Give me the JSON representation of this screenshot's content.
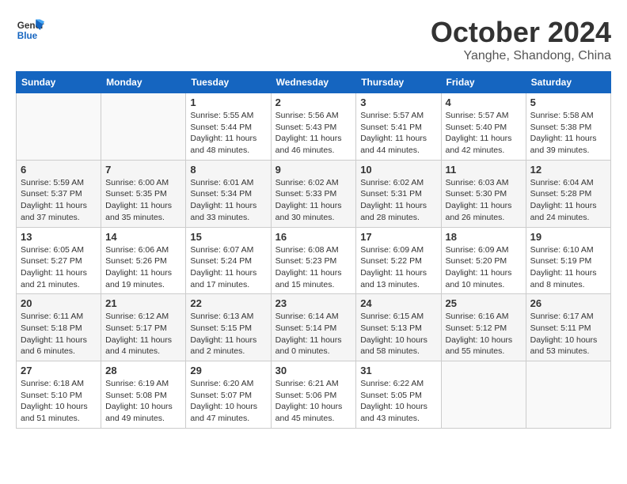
{
  "header": {
    "logo_line1": "General",
    "logo_line2": "Blue",
    "title": "October 2024",
    "subtitle": "Yanghe, Shandong, China"
  },
  "columns": [
    "Sunday",
    "Monday",
    "Tuesday",
    "Wednesday",
    "Thursday",
    "Friday",
    "Saturday"
  ],
  "weeks": [
    [
      {
        "day": "",
        "info": ""
      },
      {
        "day": "",
        "info": ""
      },
      {
        "day": "1",
        "info": "Sunrise: 5:55 AM\nSunset: 5:44 PM\nDaylight: 11 hours and 48 minutes."
      },
      {
        "day": "2",
        "info": "Sunrise: 5:56 AM\nSunset: 5:43 PM\nDaylight: 11 hours and 46 minutes."
      },
      {
        "day": "3",
        "info": "Sunrise: 5:57 AM\nSunset: 5:41 PM\nDaylight: 11 hours and 44 minutes."
      },
      {
        "day": "4",
        "info": "Sunrise: 5:57 AM\nSunset: 5:40 PM\nDaylight: 11 hours and 42 minutes."
      },
      {
        "day": "5",
        "info": "Sunrise: 5:58 AM\nSunset: 5:38 PM\nDaylight: 11 hours and 39 minutes."
      }
    ],
    [
      {
        "day": "6",
        "info": "Sunrise: 5:59 AM\nSunset: 5:37 PM\nDaylight: 11 hours and 37 minutes."
      },
      {
        "day": "7",
        "info": "Sunrise: 6:00 AM\nSunset: 5:35 PM\nDaylight: 11 hours and 35 minutes."
      },
      {
        "day": "8",
        "info": "Sunrise: 6:01 AM\nSunset: 5:34 PM\nDaylight: 11 hours and 33 minutes."
      },
      {
        "day": "9",
        "info": "Sunrise: 6:02 AM\nSunset: 5:33 PM\nDaylight: 11 hours and 30 minutes."
      },
      {
        "day": "10",
        "info": "Sunrise: 6:02 AM\nSunset: 5:31 PM\nDaylight: 11 hours and 28 minutes."
      },
      {
        "day": "11",
        "info": "Sunrise: 6:03 AM\nSunset: 5:30 PM\nDaylight: 11 hours and 26 minutes."
      },
      {
        "day": "12",
        "info": "Sunrise: 6:04 AM\nSunset: 5:28 PM\nDaylight: 11 hours and 24 minutes."
      }
    ],
    [
      {
        "day": "13",
        "info": "Sunrise: 6:05 AM\nSunset: 5:27 PM\nDaylight: 11 hours and 21 minutes."
      },
      {
        "day": "14",
        "info": "Sunrise: 6:06 AM\nSunset: 5:26 PM\nDaylight: 11 hours and 19 minutes."
      },
      {
        "day": "15",
        "info": "Sunrise: 6:07 AM\nSunset: 5:24 PM\nDaylight: 11 hours and 17 minutes."
      },
      {
        "day": "16",
        "info": "Sunrise: 6:08 AM\nSunset: 5:23 PM\nDaylight: 11 hours and 15 minutes."
      },
      {
        "day": "17",
        "info": "Sunrise: 6:09 AM\nSunset: 5:22 PM\nDaylight: 11 hours and 13 minutes."
      },
      {
        "day": "18",
        "info": "Sunrise: 6:09 AM\nSunset: 5:20 PM\nDaylight: 11 hours and 10 minutes."
      },
      {
        "day": "19",
        "info": "Sunrise: 6:10 AM\nSunset: 5:19 PM\nDaylight: 11 hours and 8 minutes."
      }
    ],
    [
      {
        "day": "20",
        "info": "Sunrise: 6:11 AM\nSunset: 5:18 PM\nDaylight: 11 hours and 6 minutes."
      },
      {
        "day": "21",
        "info": "Sunrise: 6:12 AM\nSunset: 5:17 PM\nDaylight: 11 hours and 4 minutes."
      },
      {
        "day": "22",
        "info": "Sunrise: 6:13 AM\nSunset: 5:15 PM\nDaylight: 11 hours and 2 minutes."
      },
      {
        "day": "23",
        "info": "Sunrise: 6:14 AM\nSunset: 5:14 PM\nDaylight: 11 hours and 0 minutes."
      },
      {
        "day": "24",
        "info": "Sunrise: 6:15 AM\nSunset: 5:13 PM\nDaylight: 10 hours and 58 minutes."
      },
      {
        "day": "25",
        "info": "Sunrise: 6:16 AM\nSunset: 5:12 PM\nDaylight: 10 hours and 55 minutes."
      },
      {
        "day": "26",
        "info": "Sunrise: 6:17 AM\nSunset: 5:11 PM\nDaylight: 10 hours and 53 minutes."
      }
    ],
    [
      {
        "day": "27",
        "info": "Sunrise: 6:18 AM\nSunset: 5:10 PM\nDaylight: 10 hours and 51 minutes."
      },
      {
        "day": "28",
        "info": "Sunrise: 6:19 AM\nSunset: 5:08 PM\nDaylight: 10 hours and 49 minutes."
      },
      {
        "day": "29",
        "info": "Sunrise: 6:20 AM\nSunset: 5:07 PM\nDaylight: 10 hours and 47 minutes."
      },
      {
        "day": "30",
        "info": "Sunrise: 6:21 AM\nSunset: 5:06 PM\nDaylight: 10 hours and 45 minutes."
      },
      {
        "day": "31",
        "info": "Sunrise: 6:22 AM\nSunset: 5:05 PM\nDaylight: 10 hours and 43 minutes."
      },
      {
        "day": "",
        "info": ""
      },
      {
        "day": "",
        "info": ""
      }
    ]
  ]
}
